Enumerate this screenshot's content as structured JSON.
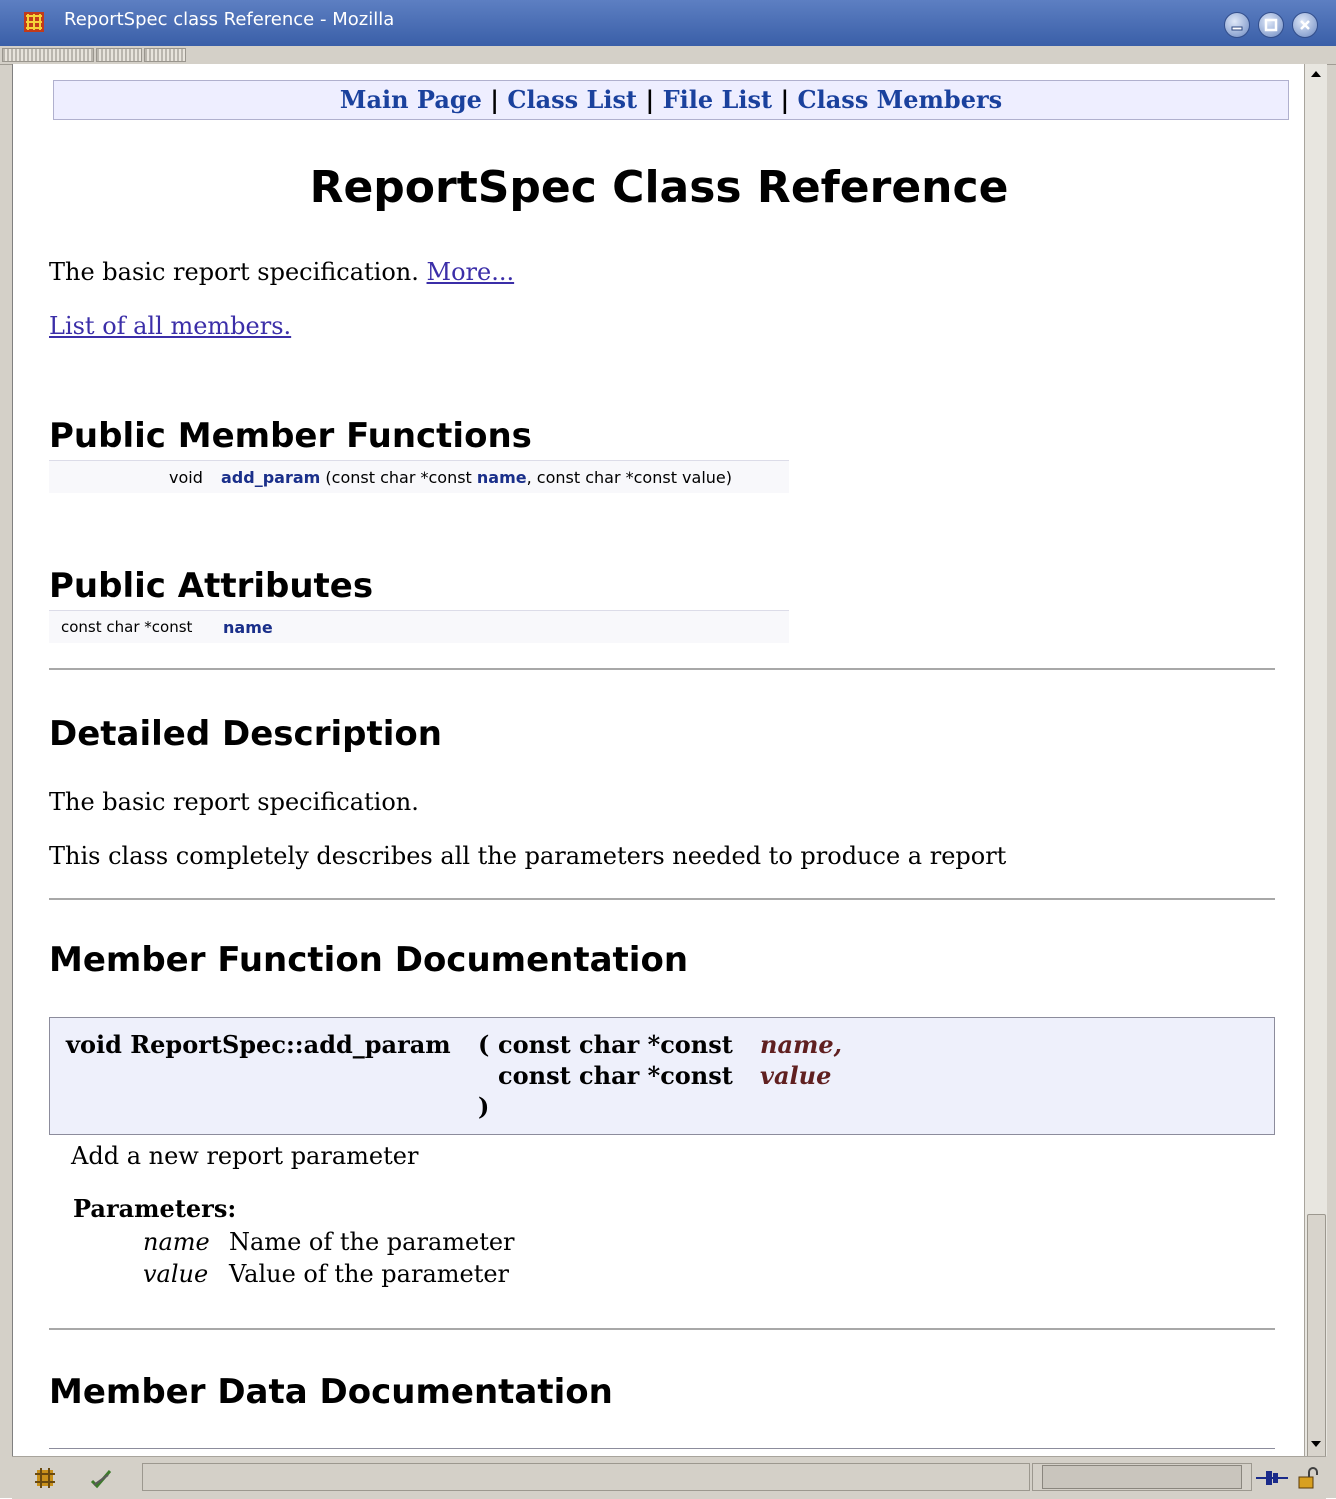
{
  "window": {
    "title": "ReportSpec class Reference - Mozilla"
  },
  "nav": {
    "main_page": "Main Page",
    "class_list": "Class List",
    "file_list": "File List",
    "class_members": "Class Members",
    "separator": "|"
  },
  "page": {
    "title": "ReportSpec Class Reference",
    "brief": "The basic report specification.",
    "more_link": "More...",
    "all_members_link": "List of all members."
  },
  "public_member_functions": {
    "heading": "Public Member Functions",
    "row": {
      "type": "void",
      "name": "add_param",
      "args_prefix": "(const char *const",
      "arg1_name": "name",
      "args_suffix": ", const char *const value)"
    }
  },
  "public_attributes": {
    "heading": "Public Attributes",
    "row": {
      "type": "const char *const",
      "name": "name"
    }
  },
  "detailed_description": {
    "heading": "Detailed Description",
    "line1": "The basic report specification.",
    "line2": "This class completely describes all the parameters needed to produce a report"
  },
  "member_function_documentation": {
    "heading": "Member Function Documentation",
    "proto": {
      "signature": "void ReportSpec::add_param",
      "open_paren": "(",
      "param1_type": "const char *const",
      "param1_name": "name,",
      "param2_type": "const char *const",
      "param2_name": "value",
      "close_paren": ")"
    },
    "description": "Add a new report parameter",
    "parameters_label": "Parameters:",
    "parameters": [
      {
        "name": "name",
        "desc": "Name of the parameter"
      },
      {
        "name": "value",
        "desc": "Value of the parameter"
      }
    ]
  },
  "member_data_documentation": {
    "heading": "Member Data Documentation"
  },
  "icons": {
    "app": "mozilla-icon",
    "minimize": "minimize-icon",
    "maximize": "maximize-icon",
    "close": "close-icon",
    "status_left_1": "mozilla-component-icon",
    "status_left_2": "pen-check-icon",
    "connection": "online-connection-icon",
    "security": "unlocked-padlock-icon"
  },
  "colors": {
    "titlebar": "#3a5fa8",
    "link": "#1a419d",
    "navbar_bg": "#eeeeff",
    "proto_bg": "#eef0fb",
    "param_name": "#602020"
  }
}
